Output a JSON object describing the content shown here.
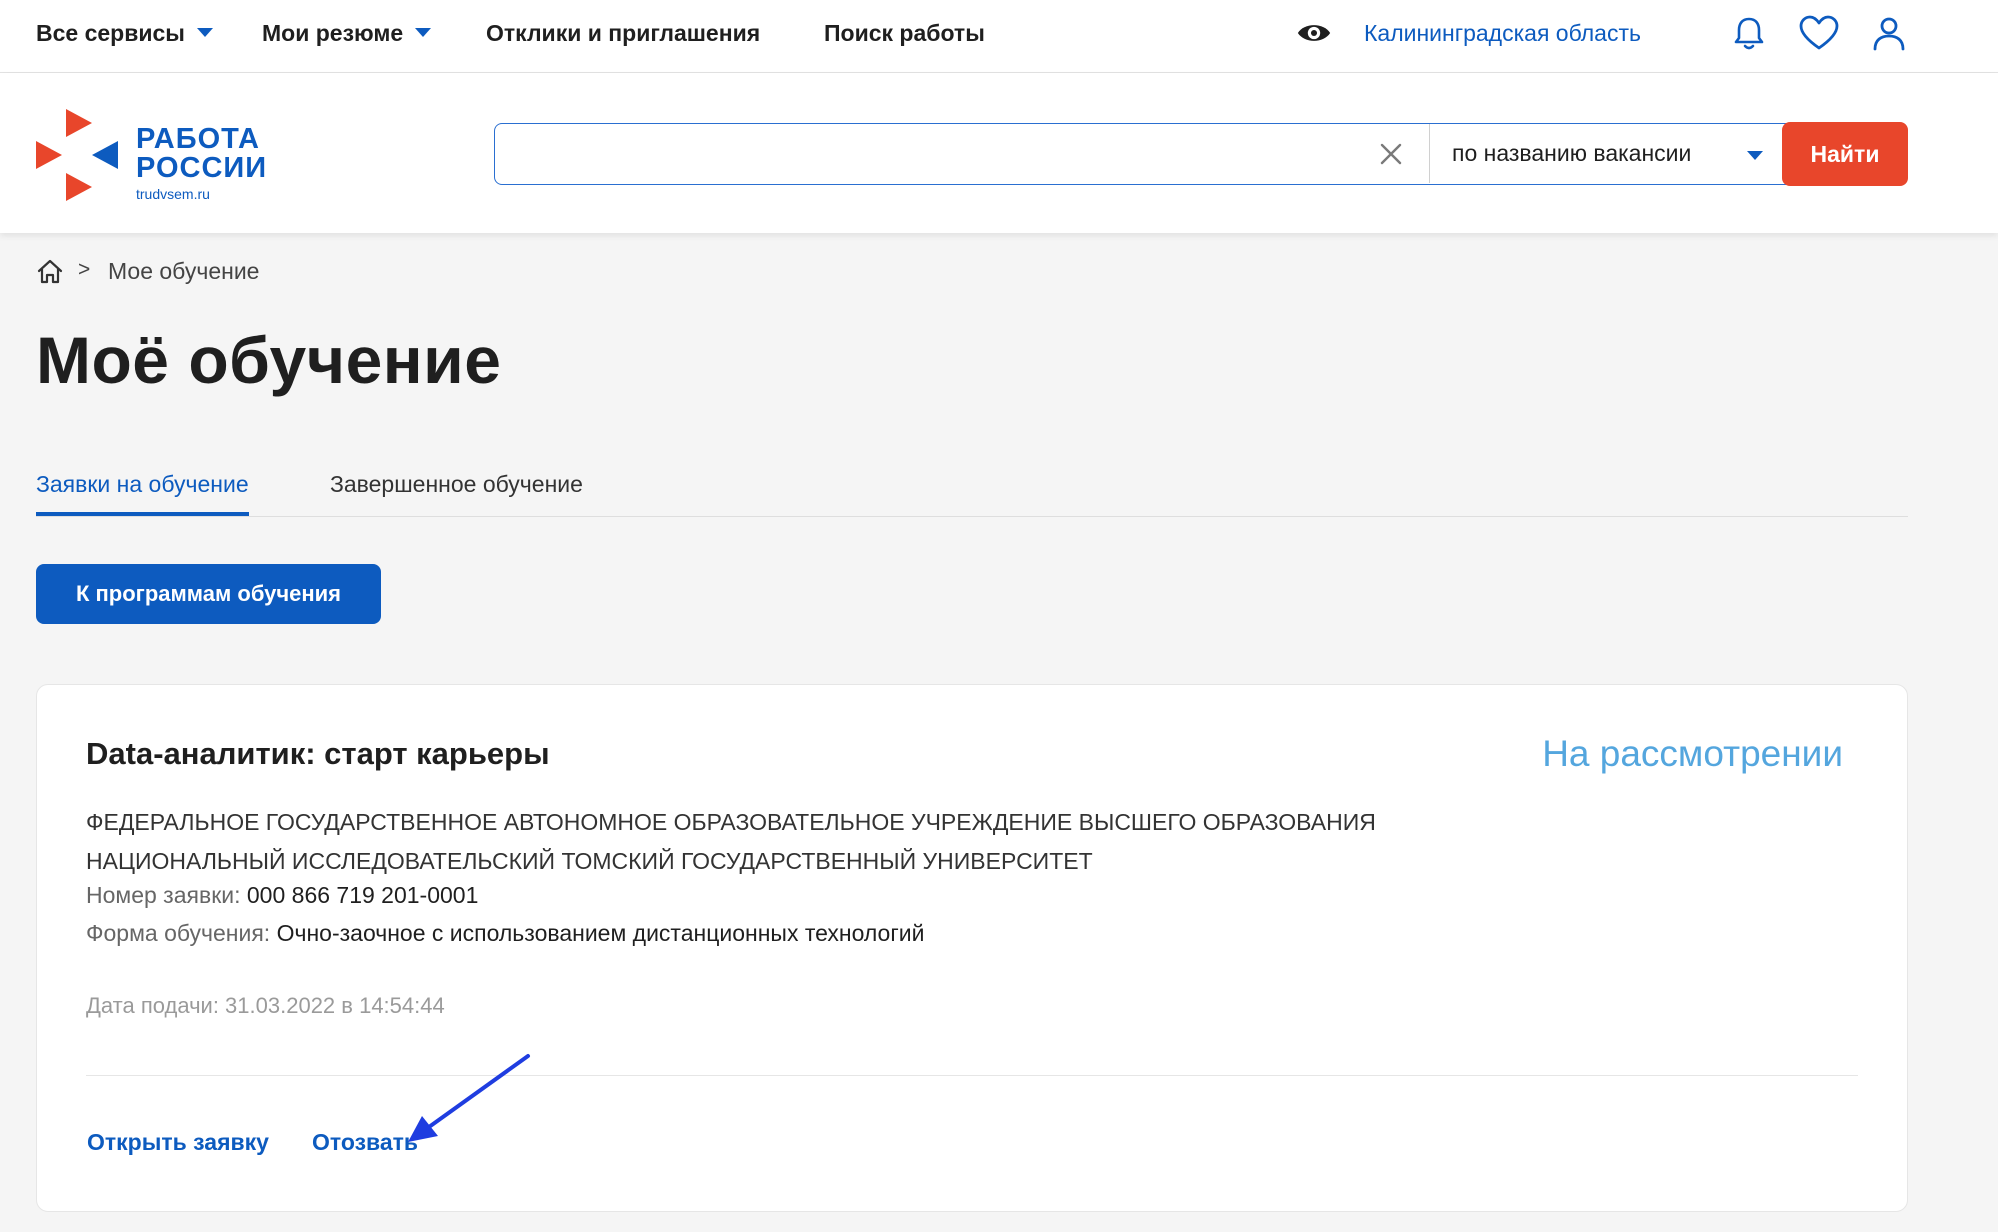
{
  "topnav": {
    "all_services": "Все сервисы",
    "my_resumes": "Мои резюме",
    "responses": "Отклики и приглашения",
    "job_search": "Поиск работы",
    "region": "Калининградская область"
  },
  "header": {
    "logo_line1": "РАБОТА",
    "logo_line2": "РОССИИ",
    "logo_site": "trudvsem.ru",
    "search_value": "",
    "search_mode": "по названию вакансии",
    "find_label": "Найти"
  },
  "breadcrumb": {
    "current": "Мое обучение"
  },
  "page": {
    "title": "Моё обучение",
    "tabs": [
      {
        "label": "Заявки на обучение",
        "active": true
      },
      {
        "label": "Завершенное обучение",
        "active": false
      }
    ],
    "programs_button": "К программам обучения"
  },
  "application": {
    "title": "Data-аналитик: старт карьеры",
    "status": "На рассмотрении",
    "org_line1": "ФЕДЕРАЛЬНОЕ ГОСУДАРСТВЕННОЕ АВТОНОМНОЕ ОБРАЗОВАТЕЛЬНОЕ УЧРЕЖДЕНИЕ ВЫСШЕГО ОБРАЗОВАНИЯ",
    "org_line2": "НАЦИОНАЛЬНЫЙ ИССЛЕДОВАТЕЛЬСКИЙ ТОМСКИЙ ГОСУДАРСТВЕННЫЙ УНИВЕРСИТЕТ",
    "number_label": "Номер заявки:",
    "number_value": "000 866 719 201-0001",
    "form_label": "Форма обучения:",
    "form_value": "Очно-заочное с использованием дистанционных технологий",
    "date_text": "Дата подачи: 31.03.2022 в 14:54:44",
    "open_link": "Открыть заявку",
    "withdraw_link": "Отозвать"
  },
  "colors": {
    "brand_blue": "#0d5bbf",
    "accent_orange": "#e8462b",
    "status_blue": "#54a6de",
    "annotation_arrow": "#1f3de0"
  }
}
